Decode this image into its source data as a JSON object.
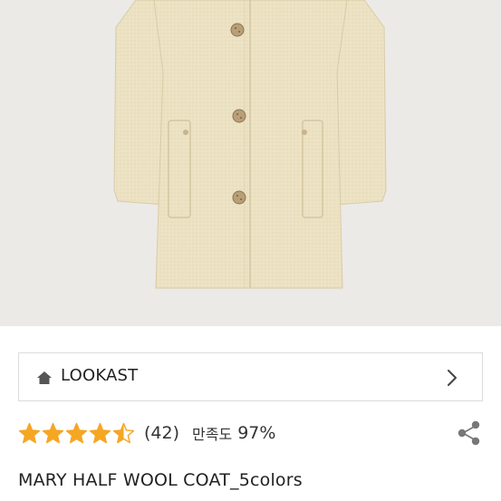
{
  "product": {
    "image_alt": "beige wool coat",
    "title": "MARY HALF WOOL COAT_5colors"
  },
  "brand": {
    "name": "LOOKAST"
  },
  "rating": {
    "stars_value": 4.5,
    "stars_max": 5,
    "review_count": "(42)",
    "satisfaction_label": "만족도",
    "satisfaction_value": "97%"
  },
  "colors": {
    "star": "#f5a623",
    "coat": "#ece1c2",
    "background": "#eceae7"
  },
  "icons": [
    "home-icon",
    "chevron-right-icon",
    "star-icon",
    "share-icon"
  ]
}
